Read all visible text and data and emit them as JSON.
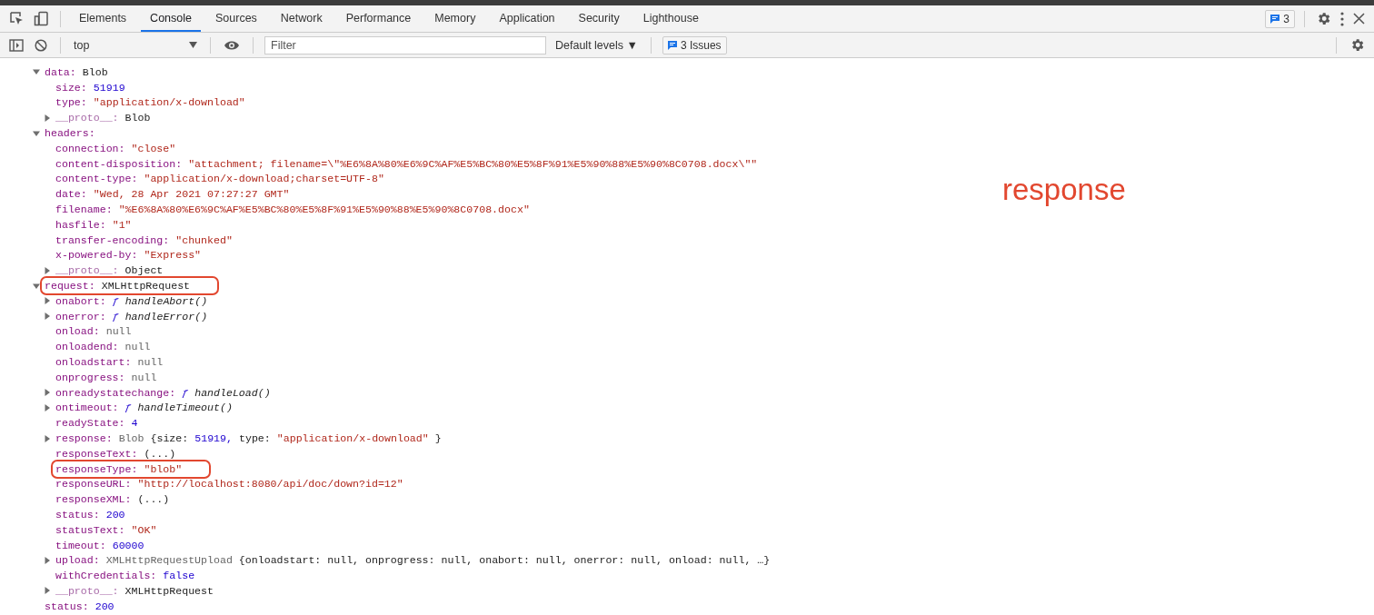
{
  "tabs": [
    {
      "label": "Elements",
      "selected": false
    },
    {
      "label": "Console",
      "selected": true
    },
    {
      "label": "Sources",
      "selected": false
    },
    {
      "label": "Network",
      "selected": false
    },
    {
      "label": "Performance",
      "selected": false
    },
    {
      "label": "Memory",
      "selected": false
    },
    {
      "label": "Application",
      "selected": false
    },
    {
      "label": "Security",
      "selected": false
    },
    {
      "label": "Lighthouse",
      "selected": false
    }
  ],
  "issues_badge": "3",
  "console_toolbar": {
    "context": "top",
    "filter": {
      "placeholder": "Filter"
    },
    "levels": "Default levels ▼",
    "issues": "3 Issues"
  },
  "tree": [
    {
      "key": "data:",
      "expanded": true,
      "value": [
        {
          "kind": "plain",
          "text": "Blob"
        }
      ],
      "children": [
        {
          "key": "size:",
          "value": [
            {
              "kind": "number",
              "text": "51919"
            }
          ]
        },
        {
          "key": "type:",
          "value": [
            {
              "kind": "string",
              "text": "\"application/x-download\""
            }
          ]
        },
        {
          "key": "__proto__:",
          "proto": true,
          "expanded": false,
          "value": [
            {
              "kind": "plain",
              "text": "Blob"
            }
          ]
        }
      ]
    },
    {
      "key": "headers:",
      "expanded": true,
      "children": [
        {
          "key": "connection:",
          "value": [
            {
              "kind": "string",
              "text": "\"close\""
            }
          ]
        },
        {
          "key": "content-disposition:",
          "value": [
            {
              "kind": "string",
              "text": "\"attachment; filename=\\\"%E6%8A%80%E6%9C%AF%E5%BC%80%E5%8F%91%E5%90%88%E5%90%8C0708.docx\\\"\""
            }
          ]
        },
        {
          "key": "content-type:",
          "value": [
            {
              "kind": "string",
              "text": "\"application/x-download;charset=UTF-8\""
            }
          ]
        },
        {
          "key": "date:",
          "value": [
            {
              "kind": "string",
              "text": "\"Wed, 28 Apr 2021 07:27:27 GMT\""
            }
          ]
        },
        {
          "key": "filename:",
          "value": [
            {
              "kind": "string",
              "text": "\"%E6%8A%80%E6%9C%AF%E5%BC%80%E5%8F%91%E5%90%88%E5%90%8C0708.docx\""
            }
          ]
        },
        {
          "key": "hasfile:",
          "value": [
            {
              "kind": "string",
              "text": "\"1\""
            }
          ]
        },
        {
          "key": "transfer-encoding:",
          "value": [
            {
              "kind": "string",
              "text": "\"chunked\""
            }
          ]
        },
        {
          "key": "x-powered-by:",
          "value": [
            {
              "kind": "string",
              "text": "\"Express\""
            }
          ]
        },
        {
          "key": "__proto__:",
          "proto": true,
          "expanded": false,
          "value": [
            {
              "kind": "plain",
              "text": "Object"
            }
          ]
        }
      ]
    },
    {
      "key": "request:",
      "expanded": true,
      "annotated": true,
      "value": [
        {
          "kind": "plain",
          "text": "XMLHttpRequest"
        }
      ],
      "children": [
        {
          "key": "onabort:",
          "expanded": false,
          "value": [
            {
              "kind": "func",
              "text": "ƒ"
            },
            {
              "kind": "funcname",
              "text": "handleAbort()"
            }
          ]
        },
        {
          "key": "onerror:",
          "expanded": false,
          "value": [
            {
              "kind": "func",
              "text": "ƒ"
            },
            {
              "kind": "funcname",
              "text": "handleError()"
            }
          ]
        },
        {
          "key": "onload:",
          "value": [
            {
              "kind": "null",
              "text": "null"
            }
          ]
        },
        {
          "key": "onloadend:",
          "value": [
            {
              "kind": "null",
              "text": "null"
            }
          ]
        },
        {
          "key": "onloadstart:",
          "value": [
            {
              "kind": "null",
              "text": "null"
            }
          ]
        },
        {
          "key": "onprogress:",
          "value": [
            {
              "kind": "null",
              "text": "null"
            }
          ]
        },
        {
          "key": "onreadystatechange:",
          "expanded": false,
          "value": [
            {
              "kind": "func",
              "text": "ƒ"
            },
            {
              "kind": "funcname",
              "text": "handleLoad()"
            }
          ]
        },
        {
          "key": "ontimeout:",
          "expanded": false,
          "value": [
            {
              "kind": "func",
              "text": "ƒ"
            },
            {
              "kind": "funcname",
              "text": "handleTimeout()"
            }
          ]
        },
        {
          "key": "readyState:",
          "value": [
            {
              "kind": "number",
              "text": "4"
            }
          ]
        },
        {
          "key": "response:",
          "expanded": false,
          "value": [
            {
              "kind": "null",
              "text": "Blob"
            },
            {
              "kind": "plain",
              "text": "{size:"
            },
            {
              "kind": "number",
              "text": "51919,"
            },
            {
              "kind": "plain",
              "text": "type:"
            },
            {
              "kind": "string",
              "text": "\"application/x-download\""
            },
            {
              "kind": "plain",
              "text": "}"
            }
          ]
        },
        {
          "key": "responseText:",
          "value": [
            {
              "kind": "plain",
              "text": "(...)"
            }
          ]
        },
        {
          "key": "responseType:",
          "annotated": true,
          "value": [
            {
              "kind": "string",
              "text": "\"blob\""
            }
          ]
        },
        {
          "key": "responseURL:",
          "value": [
            {
              "kind": "string",
              "text": "\"http://localhost:8080/api/doc/down?id=12\""
            }
          ]
        },
        {
          "key": "responseXML:",
          "value": [
            {
              "kind": "plain",
              "text": "(...)"
            }
          ]
        },
        {
          "key": "status:",
          "value": [
            {
              "kind": "number",
              "text": "200"
            }
          ]
        },
        {
          "key": "statusText:",
          "value": [
            {
              "kind": "string",
              "text": "\"OK\""
            }
          ]
        },
        {
          "key": "timeout:",
          "value": [
            {
              "kind": "number",
              "text": "60000"
            }
          ]
        },
        {
          "key": "upload:",
          "expanded": false,
          "value": [
            {
              "kind": "null",
              "text": "XMLHttpRequestUpload"
            },
            {
              "kind": "plain",
              "text": "{onloadstart: null, onprogress: null, onabort: null, onerror: null, onload: null, …}"
            }
          ]
        },
        {
          "key": "withCredentials:",
          "value": [
            {
              "kind": "number",
              "text": "false"
            }
          ]
        },
        {
          "key": "__proto__:",
          "proto": true,
          "expanded": false,
          "value": [
            {
              "kind": "plain",
              "text": "XMLHttpRequest"
            }
          ]
        }
      ]
    },
    {
      "key": "status:",
      "value": [
        {
          "kind": "number",
          "text": "200"
        }
      ]
    }
  ],
  "annotation_label": "response"
}
